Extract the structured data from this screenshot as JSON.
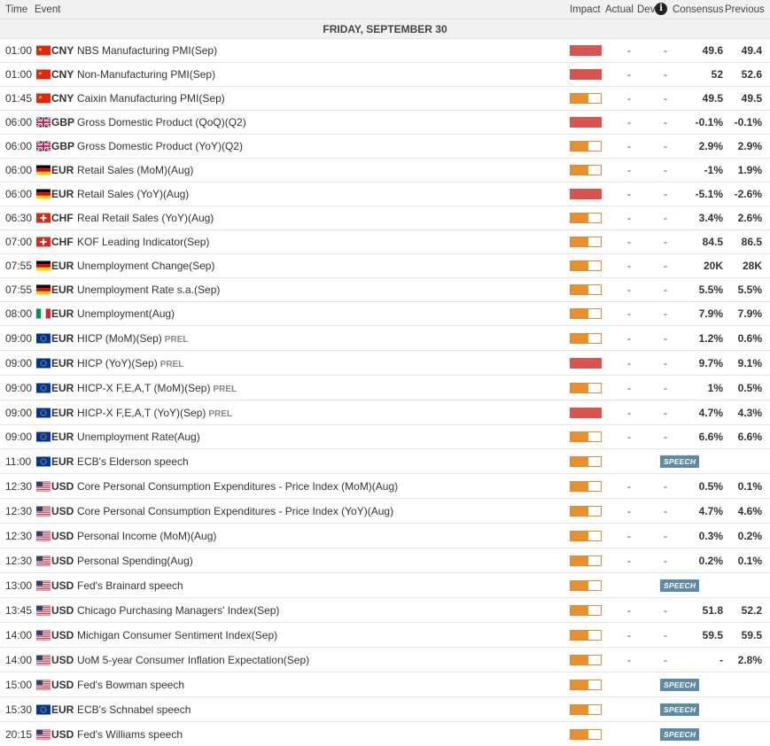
{
  "header": {
    "time": "Time",
    "event": "Event",
    "impact": "Impact",
    "actual": "Actual",
    "dev": "Dev",
    "info_icon": "i",
    "consensus": "Consensus",
    "previous": "Previous"
  },
  "day_label": "FRIDAY, SEPTEMBER 30",
  "colors": {
    "high": "#d9534f",
    "medium": "#e8902e",
    "speech_badge": "#5f8aa6"
  },
  "rows": [
    {
      "time": "01:00",
      "flag": "cn",
      "currency": "CNY",
      "event": "NBS Manufacturing PMI(Sep)",
      "prel": "",
      "impact_level": 1.0,
      "actual": "-",
      "dev": "-",
      "consensus": "49.6",
      "previous": "49.4",
      "speech": ""
    },
    {
      "time": "01:00",
      "flag": "cn",
      "currency": "CNY",
      "event": "Non-Manufacturing PMI(Sep)",
      "prel": "",
      "impact_level": 1.0,
      "actual": "-",
      "dev": "-",
      "consensus": "52",
      "previous": "52.6",
      "speech": ""
    },
    {
      "time": "01:45",
      "flag": "cn",
      "currency": "CNY",
      "event": "Caixin Manufacturing PMI(Sep)",
      "prel": "",
      "impact_level": 0.6,
      "actual": "-",
      "dev": "-",
      "consensus": "49.5",
      "previous": "49.5",
      "speech": ""
    },
    {
      "time": "06:00",
      "flag": "gb",
      "currency": "GBP",
      "event": "Gross Domestic Product (QoQ)(Q2)",
      "prel": "",
      "impact_level": 1.0,
      "actual": "-",
      "dev": "-",
      "consensus": "-0.1%",
      "previous": "-0.1%",
      "speech": ""
    },
    {
      "time": "06:00",
      "flag": "gb",
      "currency": "GBP",
      "event": "Gross Domestic Product (YoY)(Q2)",
      "prel": "",
      "impact_level": 0.6,
      "actual": "-",
      "dev": "-",
      "consensus": "2.9%",
      "previous": "2.9%",
      "speech": ""
    },
    {
      "time": "06:00",
      "flag": "de",
      "currency": "EUR",
      "event": "Retail Sales (MoM)(Aug)",
      "prel": "",
      "impact_level": 0.6,
      "actual": "-",
      "dev": "-",
      "consensus": "-1%",
      "previous": "1.9%",
      "speech": ""
    },
    {
      "time": "06:00",
      "flag": "de",
      "currency": "EUR",
      "event": "Retail Sales (YoY)(Aug)",
      "prel": "",
      "impact_level": 1.0,
      "actual": "-",
      "dev": "-",
      "consensus": "-5.1%",
      "previous": "-2.6%",
      "speech": ""
    },
    {
      "time": "06:30",
      "flag": "ch",
      "currency": "CHF",
      "event": "Real Retail Sales (YoY)(Aug)",
      "prel": "",
      "impact_level": 0.6,
      "actual": "-",
      "dev": "-",
      "consensus": "3.4%",
      "previous": "2.6%",
      "speech": ""
    },
    {
      "time": "07:00",
      "flag": "ch",
      "currency": "CHF",
      "event": "KOF Leading Indicator(Sep)",
      "prel": "",
      "impact_level": 0.6,
      "actual": "-",
      "dev": "-",
      "consensus": "84.5",
      "previous": "86.5",
      "speech": ""
    },
    {
      "time": "07:55",
      "flag": "de",
      "currency": "EUR",
      "event": "Unemployment Change(Sep)",
      "prel": "",
      "impact_level": 0.6,
      "actual": "-",
      "dev": "-",
      "consensus": "20K",
      "previous": "28K",
      "speech": ""
    },
    {
      "time": "07:55",
      "flag": "de",
      "currency": "EUR",
      "event": "Unemployment Rate s.a.(Sep)",
      "prel": "",
      "impact_level": 0.6,
      "actual": "-",
      "dev": "-",
      "consensus": "5.5%",
      "previous": "5.5%",
      "speech": ""
    },
    {
      "time": "08:00",
      "flag": "it",
      "currency": "EUR",
      "event": "Unemployment(Aug)",
      "prel": "",
      "impact_level": 0.6,
      "actual": "-",
      "dev": "-",
      "consensus": "7.9%",
      "previous": "7.9%",
      "speech": ""
    },
    {
      "time": "09:00",
      "flag": "eu",
      "currency": "EUR",
      "event": "HICP (MoM)(Sep)",
      "prel": "PREL",
      "impact_level": 0.6,
      "actual": "-",
      "dev": "-",
      "consensus": "1.2%",
      "previous": "0.6%",
      "speech": ""
    },
    {
      "time": "09:00",
      "flag": "eu",
      "currency": "EUR",
      "event": "HICP (YoY)(Sep)",
      "prel": "PREL",
      "impact_level": 1.0,
      "actual": "-",
      "dev": "-",
      "consensus": "9.7%",
      "previous": "9.1%",
      "speech": ""
    },
    {
      "time": "09:00",
      "flag": "eu",
      "currency": "EUR",
      "event": "HICP-X F,E,A,T (MoM)(Sep)",
      "prel": "PREL",
      "impact_level": 0.6,
      "actual": "-",
      "dev": "-",
      "consensus": "1%",
      "previous": "0.5%",
      "speech": ""
    },
    {
      "time": "09:00",
      "flag": "eu",
      "currency": "EUR",
      "event": "HICP-X F,E,A,T (YoY)(Sep)",
      "prel": "PREL",
      "impact_level": 1.0,
      "actual": "-",
      "dev": "-",
      "consensus": "4.7%",
      "previous": "4.3%",
      "speech": ""
    },
    {
      "time": "09:00",
      "flag": "eu",
      "currency": "EUR",
      "event": "Unemployment Rate(Aug)",
      "prel": "",
      "impact_level": 0.6,
      "actual": "-",
      "dev": "-",
      "consensus": "6.6%",
      "previous": "6.6%",
      "speech": ""
    },
    {
      "time": "11:00",
      "flag": "eu",
      "currency": "EUR",
      "event": "ECB's Elderson speech",
      "prel": "",
      "impact_level": 0.6,
      "actual": "",
      "dev": "",
      "consensus": "",
      "previous": "",
      "speech": "SPEECH"
    },
    {
      "time": "12:30",
      "flag": "us",
      "currency": "USD",
      "event": "Core Personal Consumption Expenditures - Price Index (MoM)(Aug)",
      "prel": "",
      "impact_level": 0.6,
      "actual": "-",
      "dev": "-",
      "consensus": "0.5%",
      "previous": "0.1%",
      "speech": ""
    },
    {
      "time": "12:30",
      "flag": "us",
      "currency": "USD",
      "event": "Core Personal Consumption Expenditures - Price Index (YoY)(Aug)",
      "prel": "",
      "impact_level": 0.6,
      "actual": "-",
      "dev": "-",
      "consensus": "4.7%",
      "previous": "4.6%",
      "speech": ""
    },
    {
      "time": "12:30",
      "flag": "us",
      "currency": "USD",
      "event": "Personal Income (MoM)(Aug)",
      "prel": "",
      "impact_level": 0.6,
      "actual": "-",
      "dev": "-",
      "consensus": "0.3%",
      "previous": "0.2%",
      "speech": ""
    },
    {
      "time": "12:30",
      "flag": "us",
      "currency": "USD",
      "event": "Personal Spending(Aug)",
      "prel": "",
      "impact_level": 0.6,
      "actual": "-",
      "dev": "-",
      "consensus": "0.2%",
      "previous": "0.1%",
      "speech": ""
    },
    {
      "time": "13:00",
      "flag": "us",
      "currency": "USD",
      "event": "Fed's Brainard speech",
      "prel": "",
      "impact_level": 0.6,
      "actual": "",
      "dev": "",
      "consensus": "",
      "previous": "",
      "speech": "SPEECH"
    },
    {
      "time": "13:45",
      "flag": "us",
      "currency": "USD",
      "event": "Chicago Purchasing Managers' Index(Sep)",
      "prel": "",
      "impact_level": 0.6,
      "actual": "-",
      "dev": "-",
      "consensus": "51.8",
      "previous": "52.2",
      "speech": ""
    },
    {
      "time": "14:00",
      "flag": "us",
      "currency": "USD",
      "event": "Michigan Consumer Sentiment Index(Sep)",
      "prel": "",
      "impact_level": 0.6,
      "actual": "-",
      "dev": "-",
      "consensus": "59.5",
      "previous": "59.5",
      "speech": ""
    },
    {
      "time": "14:00",
      "flag": "us",
      "currency": "USD",
      "event": "UoM 5-year Consumer Inflation Expectation(Sep)",
      "prel": "",
      "impact_level": 0.6,
      "actual": "-",
      "dev": "-",
      "consensus": "-",
      "previous": "2.8%",
      "speech": ""
    },
    {
      "time": "15:00",
      "flag": "us",
      "currency": "USD",
      "event": "Fed's Bowman speech",
      "prel": "",
      "impact_level": 0.6,
      "actual": "",
      "dev": "",
      "consensus": "",
      "previous": "",
      "speech": "SPEECH"
    },
    {
      "time": "15:30",
      "flag": "eu",
      "currency": "EUR",
      "event": "ECB's Schnabel speech",
      "prel": "",
      "impact_level": 0.6,
      "actual": "",
      "dev": "",
      "consensus": "",
      "previous": "",
      "speech": "SPEECH"
    },
    {
      "time": "20:15",
      "flag": "us",
      "currency": "USD",
      "event": "Fed's Williams speech",
      "prel": "",
      "impact_level": 0.6,
      "actual": "",
      "dev": "",
      "consensus": "",
      "previous": "",
      "speech": "SPEECH"
    }
  ]
}
